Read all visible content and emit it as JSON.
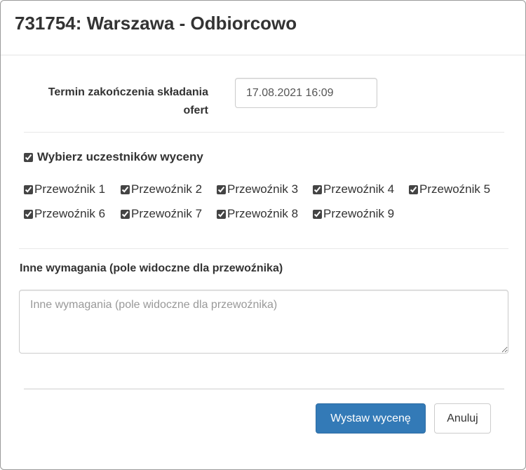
{
  "modal": {
    "title": "731754: Warszawa - Odbiorcowo"
  },
  "offer_deadline": {
    "label": "Termin zakończenia składania ofert",
    "value": "17.08.2021 16:09"
  },
  "participants": {
    "select_all_label": "Wybierz uczestników wyceny",
    "select_all_checked": true,
    "carriers": [
      {
        "label": "Przewoźnik 1",
        "checked": true
      },
      {
        "label": "Przewoźnik 2",
        "checked": true
      },
      {
        "label": "Przewoźnik 3",
        "checked": true
      },
      {
        "label": "Przewoźnik 4",
        "checked": true
      },
      {
        "label": "Przewoźnik 5",
        "checked": true
      },
      {
        "label": "Przewoźnik 6",
        "checked": true
      },
      {
        "label": "Przewoźnik 7",
        "checked": true
      },
      {
        "label": "Przewoźnik 8",
        "checked": true
      },
      {
        "label": "Przewoźnik 9",
        "checked": true
      }
    ]
  },
  "requirements": {
    "label": "Inne wymagania (pole widoczne dla przewoźnika)",
    "placeholder": "Inne wymagania (pole widoczne dla przewoźnika)",
    "value": ""
  },
  "footer": {
    "submit_label": "Wystaw wycenę",
    "cancel_label": "Anuluj"
  },
  "colors": {
    "primary": "#337ab7",
    "text": "#333333",
    "border": "#cccccc"
  }
}
